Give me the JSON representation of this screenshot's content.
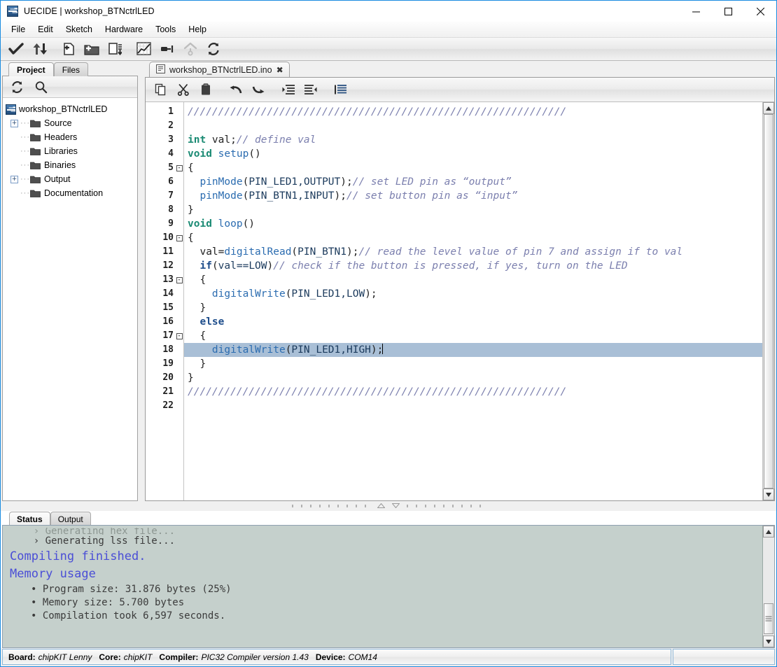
{
  "window": {
    "title": "UECIDE | workshop_BTNctrlLED",
    "app_icon": "uecide-logo-icon",
    "controls": [
      {
        "name": "minimize",
        "glyph": "—"
      },
      {
        "name": "maximize",
        "glyph": "☐"
      },
      {
        "name": "close",
        "glyph": "✕"
      }
    ]
  },
  "menubar": {
    "items": [
      "File",
      "Edit",
      "Sketch",
      "Hardware",
      "Tools",
      "Help"
    ]
  },
  "toolbar": {
    "buttons": [
      {
        "name": "verify-compile-button",
        "icon": "check-icon",
        "title": "Verify / Compile"
      },
      {
        "name": "upload-button",
        "icon": "upload-download-arrows-icon",
        "title": "Upload"
      },
      {
        "name": "new-sketch-button",
        "icon": "new-file-icon",
        "title": "New Sketch"
      },
      {
        "name": "open-sketch-button",
        "icon": "open-folder-icon",
        "title": "Open Sketch"
      },
      {
        "name": "save-sketch-button",
        "icon": "save-disk-icon",
        "title": "Save Sketch"
      },
      {
        "name": "plotter-button",
        "icon": "chart-plotter-icon",
        "title": "Plotter"
      },
      {
        "name": "serial-terminal-button",
        "icon": "serial-plug-icon",
        "title": "Serial Terminal"
      },
      {
        "name": "program-board-button",
        "icon": "chevron-up-program-icon",
        "title": "Program Board"
      },
      {
        "name": "refresh-button",
        "icon": "refresh-arrows-icon",
        "title": "Refresh"
      }
    ]
  },
  "left_panel": {
    "tabs": [
      {
        "label": "Project",
        "active": true
      },
      {
        "label": "Files",
        "active": false
      }
    ],
    "tools": [
      {
        "name": "refresh-tree-button",
        "icon": "refresh-arrows-icon"
      },
      {
        "name": "search-tree-button",
        "icon": "search-icon"
      }
    ],
    "tree": {
      "root": {
        "label": "workshop_BTNctrlLED",
        "icon": "uecide-logo-icon"
      },
      "children": [
        {
          "label": "Source",
          "icon": "folder-icon",
          "expander": "+"
        },
        {
          "label": "Headers",
          "icon": "folder-icon",
          "expander": ""
        },
        {
          "label": "Libraries",
          "icon": "folder-icon",
          "expander": ""
        },
        {
          "label": "Binaries",
          "icon": "folder-icon",
          "expander": ""
        },
        {
          "label": "Output",
          "icon": "folder-icon",
          "expander": "+"
        },
        {
          "label": "Documentation",
          "icon": "folder-icon",
          "expander": ""
        }
      ]
    }
  },
  "editor": {
    "tab": {
      "label": "workshop_BTNctrlLED.ino",
      "icon": "file-document-icon",
      "close_glyph": "✖"
    },
    "tools": [
      {
        "name": "copy-button",
        "icon": "copy-icon"
      },
      {
        "name": "cut-button",
        "icon": "scissors-cut-icon"
      },
      {
        "name": "paste-button",
        "icon": "clipboard-paste-icon"
      },
      {
        "name": "undo-button",
        "icon": "undo-arrow-icon"
      },
      {
        "name": "redo-button",
        "icon": "redo-arrow-icon"
      },
      {
        "name": "indent-button",
        "icon": "indent-right-icon"
      },
      {
        "name": "outdent-button",
        "icon": "indent-left-icon"
      },
      {
        "name": "format-code-button",
        "icon": "format-lines-icon"
      }
    ],
    "current_line": 18,
    "lines": [
      {
        "n": 1,
        "fold": "",
        "tokens": [
          {
            "t": "//////////////////////////////////////////////////////////////",
            "c": "cm"
          }
        ]
      },
      {
        "n": 2,
        "fold": "",
        "tokens": []
      },
      {
        "n": 3,
        "fold": "",
        "tokens": [
          {
            "t": "int",
            "c": "k"
          },
          {
            "t": " val;",
            "c": "pl"
          },
          {
            "t": "// define val",
            "c": "cm"
          }
        ]
      },
      {
        "n": 4,
        "fold": "",
        "tokens": [
          {
            "t": "void",
            "c": "k"
          },
          {
            "t": " ",
            "c": "pl"
          },
          {
            "t": "setup",
            "c": "fn"
          },
          {
            "t": "()",
            "c": "pl"
          }
        ]
      },
      {
        "n": 5,
        "fold": "-",
        "tokens": [
          {
            "t": "{",
            "c": "pl"
          }
        ]
      },
      {
        "n": 6,
        "fold": "",
        "tokens": [
          {
            "t": "  ",
            "c": "pl"
          },
          {
            "t": "pinMode",
            "c": "fn"
          },
          {
            "t": "(",
            "c": "pl"
          },
          {
            "t": "PIN_LED1,OUTPUT",
            "c": "pn"
          },
          {
            "t": ");",
            "c": "pl"
          },
          {
            "t": "// set LED pin as “output”",
            "c": "cm"
          }
        ]
      },
      {
        "n": 7,
        "fold": "",
        "tokens": [
          {
            "t": "  ",
            "c": "pl"
          },
          {
            "t": "pinMode",
            "c": "fn"
          },
          {
            "t": "(",
            "c": "pl"
          },
          {
            "t": "PIN_BTN1,INPUT",
            "c": "pn"
          },
          {
            "t": ");",
            "c": "pl"
          },
          {
            "t": "// set button pin as “input”",
            "c": "cm"
          }
        ]
      },
      {
        "n": 8,
        "fold": "",
        "tokens": [
          {
            "t": "}",
            "c": "pl"
          }
        ]
      },
      {
        "n": 9,
        "fold": "",
        "tokens": [
          {
            "t": "void",
            "c": "k"
          },
          {
            "t": " ",
            "c": "pl"
          },
          {
            "t": "loop",
            "c": "fn"
          },
          {
            "t": "()",
            "c": "pl"
          }
        ]
      },
      {
        "n": 10,
        "fold": "-",
        "tokens": [
          {
            "t": "{",
            "c": "pl"
          }
        ]
      },
      {
        "n": 11,
        "fold": "",
        "tokens": [
          {
            "t": "  val=",
            "c": "pl"
          },
          {
            "t": "digitalRead",
            "c": "fn"
          },
          {
            "t": "(",
            "c": "pl"
          },
          {
            "t": "PIN_BTN1",
            "c": "pn"
          },
          {
            "t": ");",
            "c": "pl"
          },
          {
            "t": "// read the level value of pin 7 and assign if to val",
            "c": "cm"
          }
        ]
      },
      {
        "n": 12,
        "fold": "",
        "tokens": [
          {
            "t": "  ",
            "c": "pl"
          },
          {
            "t": "if",
            "c": "kc"
          },
          {
            "t": "(",
            "c": "pl"
          },
          {
            "t": "val==LOW",
            "c": "pn"
          },
          {
            "t": ")",
            "c": "pl"
          },
          {
            "t": "// check if the button is pressed, if yes, turn on the LED",
            "c": "cm"
          }
        ]
      },
      {
        "n": 13,
        "fold": "-",
        "tokens": [
          {
            "t": "  {",
            "c": "pl"
          }
        ]
      },
      {
        "n": 14,
        "fold": "",
        "tokens": [
          {
            "t": "    ",
            "c": "pl"
          },
          {
            "t": "digitalWrite",
            "c": "fn"
          },
          {
            "t": "(",
            "c": "pl"
          },
          {
            "t": "PIN_LED1,LOW",
            "c": "pn"
          },
          {
            "t": ");",
            "c": "pl"
          }
        ]
      },
      {
        "n": 15,
        "fold": "",
        "tokens": [
          {
            "t": "  }",
            "c": "pl"
          }
        ]
      },
      {
        "n": 16,
        "fold": "",
        "tokens": [
          {
            "t": "  ",
            "c": "pl"
          },
          {
            "t": "else",
            "c": "kc"
          }
        ]
      },
      {
        "n": 17,
        "fold": "-",
        "tokens": [
          {
            "t": "  {",
            "c": "pl"
          }
        ]
      },
      {
        "n": 18,
        "fold": "",
        "tokens": [
          {
            "t": "    ",
            "c": "pl"
          },
          {
            "t": "digitalWrite",
            "c": "fn"
          },
          {
            "t": "(",
            "c": "pl"
          },
          {
            "t": "PIN_LED1,HIGH",
            "c": "pn"
          },
          {
            "t": ");",
            "c": "pl"
          }
        ]
      },
      {
        "n": 19,
        "fold": "",
        "tokens": [
          {
            "t": "  }",
            "c": "pl"
          }
        ]
      },
      {
        "n": 20,
        "fold": "",
        "tokens": [
          {
            "t": "}",
            "c": "pl"
          }
        ]
      },
      {
        "n": 21,
        "fold": "",
        "tokens": [
          {
            "t": "//////////////////////////////////////////////////////////////",
            "c": "cm"
          }
        ]
      },
      {
        "n": 22,
        "fold": "",
        "tokens": []
      }
    ]
  },
  "console": {
    "tabs": [
      {
        "label": "Status",
        "active": true
      },
      {
        "label": "Output",
        "active": false
      }
    ],
    "lines": [
      {
        "text": "    › Generating hex file...",
        "style": "clip"
      },
      {
        "text": "    › Generating lss file...",
        "style": "plain"
      },
      {
        "text": "Compiling finished.",
        "style": "head"
      },
      {
        "text": "Memory usage",
        "style": "head"
      },
      {
        "text": "• Program size: 31.876 bytes (25%)",
        "style": "bullet"
      },
      {
        "text": "• Memory size: 5.700 bytes",
        "style": "bullet"
      },
      {
        "text": "• Compilation took 6,597 seconds.",
        "style": "bullet"
      }
    ]
  },
  "statusbar": {
    "fields": [
      {
        "label": "Board:",
        "value": "chipKIT Lenny"
      },
      {
        "label": "Core:",
        "value": "chipKIT"
      },
      {
        "label": "Compiler:",
        "value": "PIC32 Compiler version 1.43"
      },
      {
        "label": "Device:",
        "value": "COM14"
      }
    ]
  },
  "colors": {
    "accent_border": "#1a8ce0",
    "console_bg": "#c5d0cc",
    "console_heading": "#4a4ed6",
    "highlight_line": "#a9bfd6",
    "comment": "#7b7fae",
    "keyword": "#1a8a73",
    "function": "#2b6cb0"
  }
}
